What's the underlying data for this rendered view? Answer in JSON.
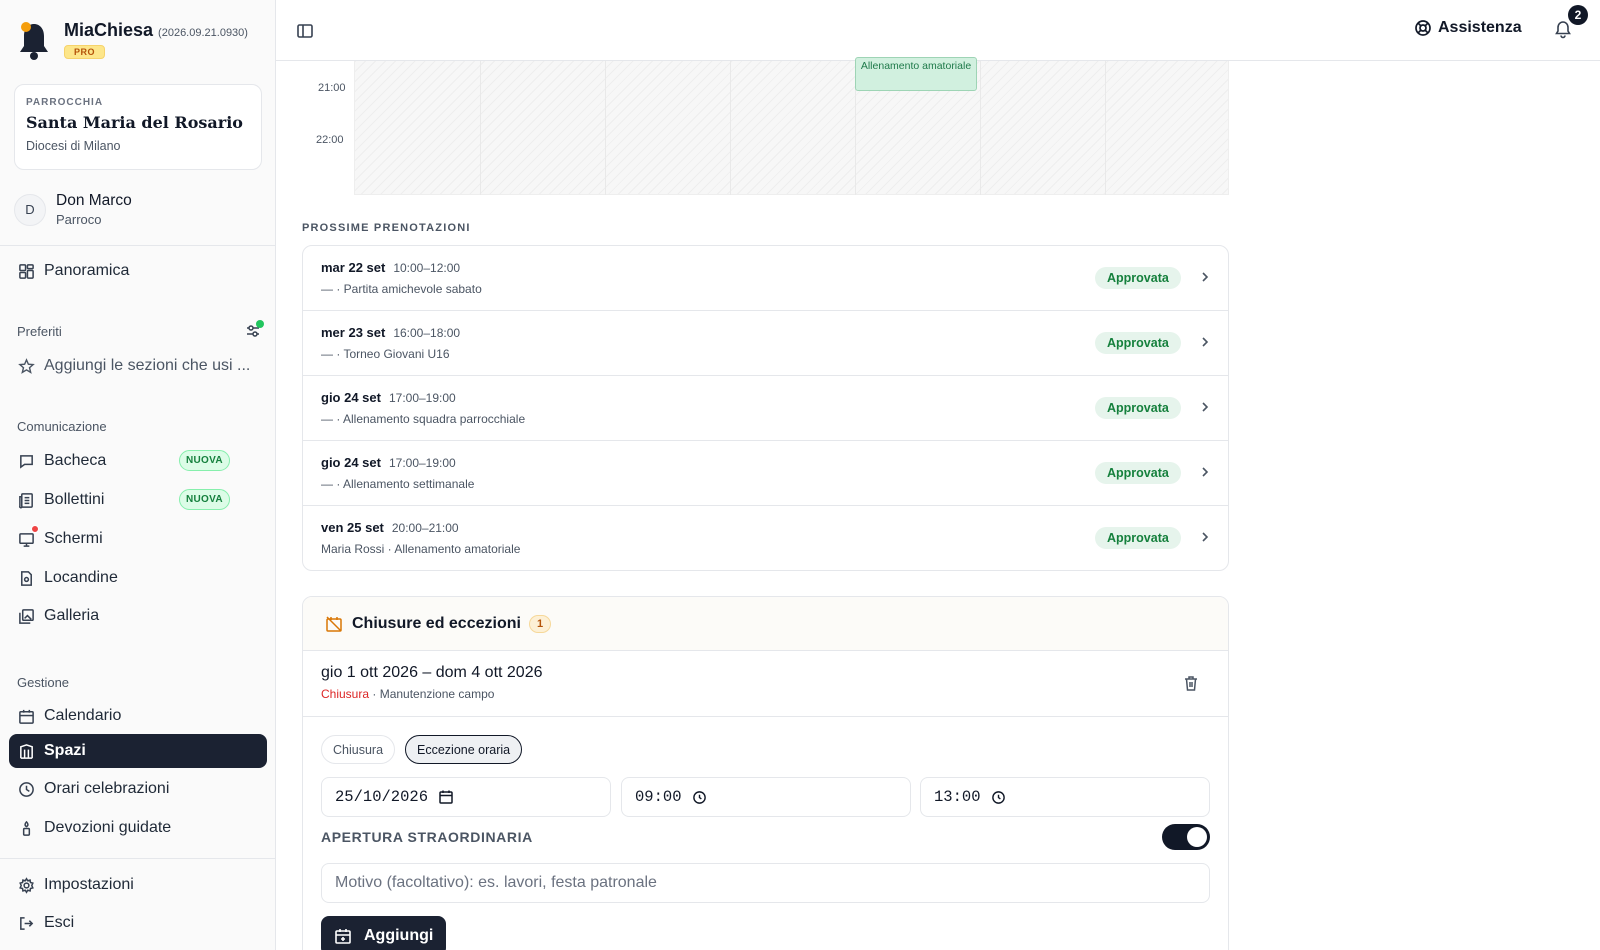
{
  "app": {
    "name": "MiaChiesa",
    "version": "(2026.09.21.0930)",
    "plan_badge": "PRO"
  },
  "parish": {
    "kicker": "PARROCCHIA",
    "name": "Santa Maria del Rosario",
    "diocese": "Diocesi di Milano"
  },
  "user": {
    "initial": "D",
    "name": "Don Marco",
    "role": "Parroco"
  },
  "sidebar": {
    "overview": "Panoramica",
    "favorites_label": "Preferiti",
    "favorites_placeholder": "Aggiungi le sezioni che usi ...",
    "communication_label": "Comunicazione",
    "communication": [
      {
        "label": "Bacheca",
        "badge": "NUOVA"
      },
      {
        "label": "Bollettini",
        "badge": "NUOVA"
      },
      {
        "label": "Schermi"
      },
      {
        "label": "Locandine"
      },
      {
        "label": "Galleria"
      }
    ],
    "management_label": "Gestione",
    "management": [
      {
        "label": "Calendario"
      },
      {
        "label": "Spazi"
      },
      {
        "label": "Orari celebrazioni"
      },
      {
        "label": "Devozioni guidate"
      }
    ],
    "settings": "Impostazioni",
    "logout": "Esci"
  },
  "topbar": {
    "help_label": "Assistenza",
    "notification_count": "2"
  },
  "calendar": {
    "times": [
      "21:00",
      "22:00"
    ],
    "event_label": "Allenamento amatoriale"
  },
  "bookings": {
    "section_title": "PROSSIME PRENOTAZIONI",
    "items": [
      {
        "date": "mar 22 set",
        "time": "10:00–12:00",
        "desc": "— · Partita amichevole sabato",
        "status": "Approvata"
      },
      {
        "date": "mer 23 set",
        "time": "16:00–18:00",
        "desc": "— · Torneo Giovani U16",
        "status": "Approvata"
      },
      {
        "date": "gio 24 set",
        "time": "17:00–19:00",
        "desc": "— · Allenamento squadra parrocchiale",
        "status": "Approvata"
      },
      {
        "date": "gio 24 set",
        "time": "17:00–19:00",
        "desc": "— · Allenamento settimanale",
        "status": "Approvata"
      },
      {
        "date": "ven 25 set",
        "time": "20:00–21:00",
        "desc": "Maria Rossi · Allenamento amatoriale",
        "status": "Approvata"
      }
    ]
  },
  "closures": {
    "title": "Chiusure ed eccezioni",
    "count": "1",
    "item": {
      "range": "gio 1 ott 2026 – dom 4 ott 2026",
      "kind": "Chiusura",
      "reason": " · Manutenzione campo"
    },
    "form": {
      "type_options": [
        "Chiusura",
        "Eccezione oraria"
      ],
      "selected_type": "Eccezione oraria",
      "date_value": "25/10/2026",
      "start_time": "09:00",
      "end_time": "13:00",
      "extraordinary_label": "APERTURA STRAORDINARIA",
      "extraordinary_on": true,
      "reason_placeholder": "Motivo (facoltativo): es. lavori, festa patronale",
      "submit_label": "Aggiungi"
    }
  }
}
